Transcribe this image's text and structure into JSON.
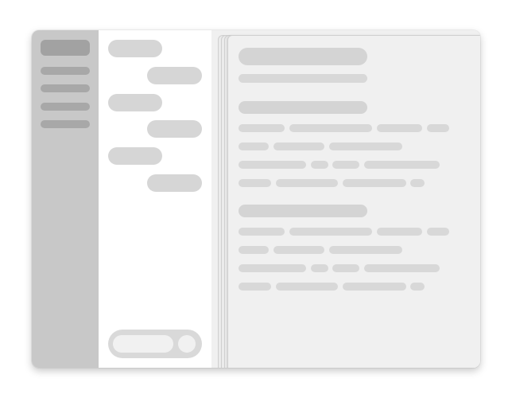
{
  "app": {
    "description_note": ""
  },
  "sidebar": {
    "items": [
      {
        "label": "",
        "active": true
      },
      {
        "label": ""
      },
      {
        "label": ""
      },
      {
        "label": ""
      },
      {
        "label": ""
      }
    ]
  },
  "chat": {
    "messages": [
      {
        "role": "assistant",
        "text": ""
      },
      {
        "role": "user",
        "text": ""
      },
      {
        "role": "assistant",
        "text": ""
      },
      {
        "role": "user",
        "text": ""
      },
      {
        "role": "assistant",
        "text": ""
      },
      {
        "role": "user",
        "text": ""
      }
    ],
    "composer": {
      "value": "",
      "placeholder": ""
    }
  },
  "document": {
    "title": "",
    "subtitle": "",
    "sections": [
      {
        "heading": "",
        "lines": []
      },
      {
        "heading": "",
        "lines": []
      }
    ]
  },
  "colors": {
    "sidebar_bg": "#c8c8c8",
    "chat_bg": "#ffffff",
    "document_bg": "#f0f0f0",
    "placeholder_bar": "#d8d8d8"
  }
}
